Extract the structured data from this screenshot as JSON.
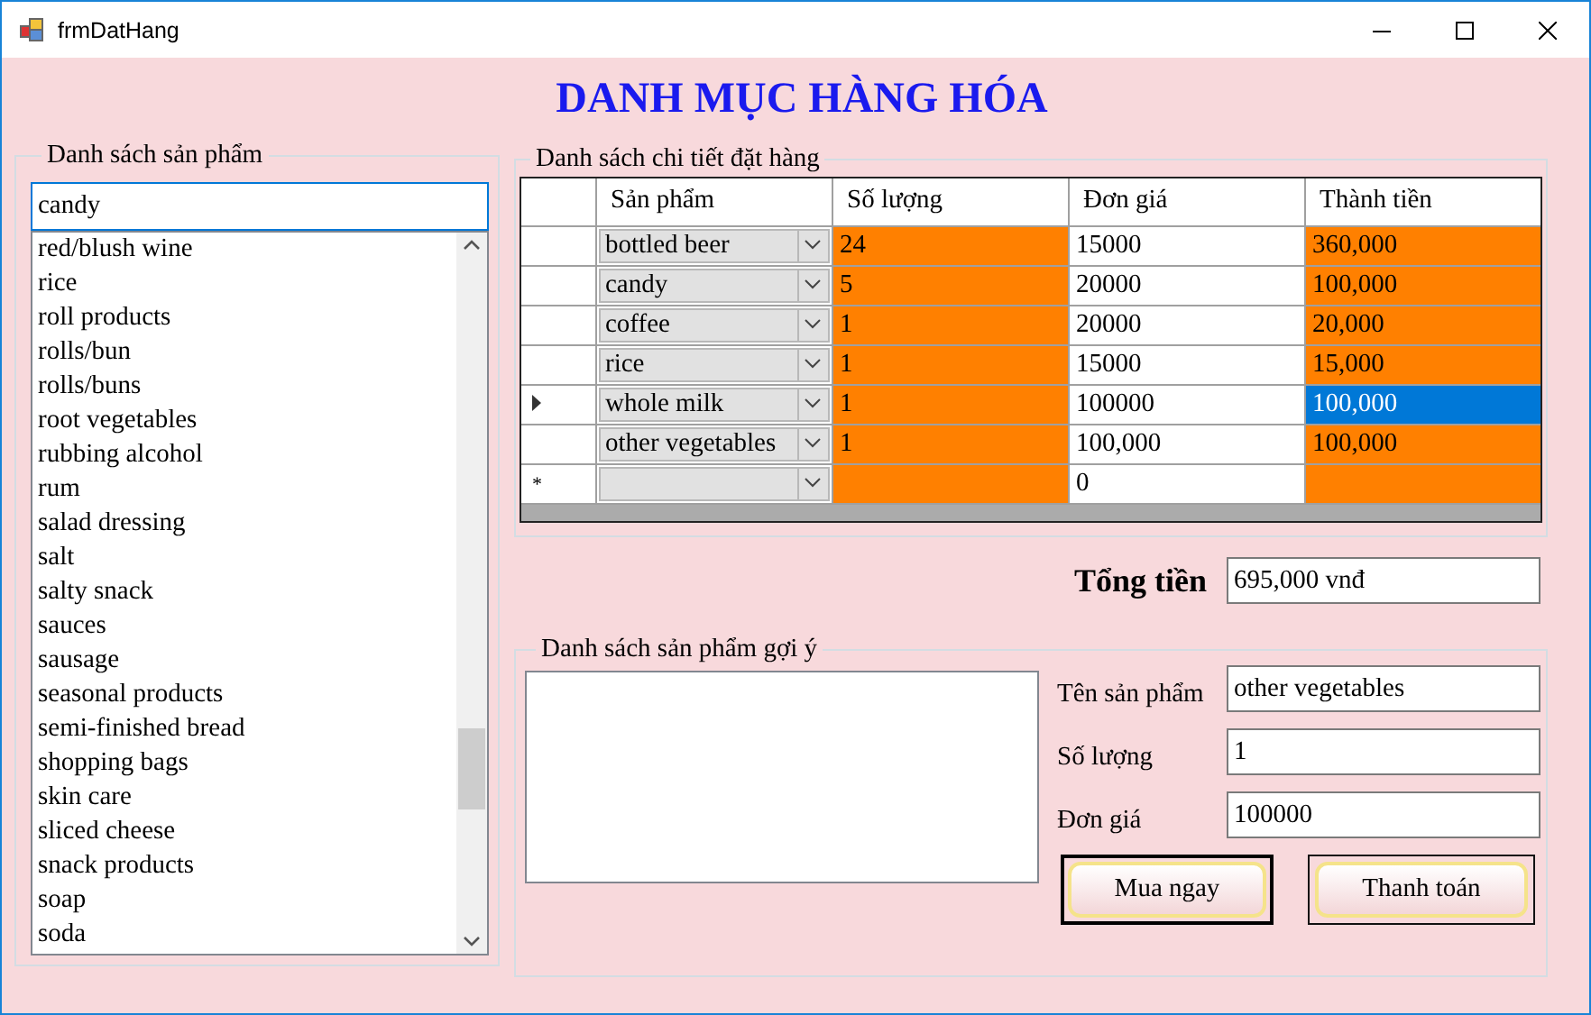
{
  "window": {
    "title": "frmDatHang"
  },
  "heading": "DANH MỤC HÀNG HÓA",
  "products": {
    "title": "Danh sách sản phẩm",
    "search": {
      "value": "candy"
    },
    "items": [
      {
        "label": "red/blush wine",
        "selected": false
      },
      {
        "label": "rice",
        "selected": false
      },
      {
        "label": "roll products",
        "selected": false
      },
      {
        "label": "rolls/bun",
        "selected": false
      },
      {
        "label": "rolls/buns",
        "selected": false
      },
      {
        "label": "root vegetables",
        "selected": false
      },
      {
        "label": "rubbing alcohol",
        "selected": false
      },
      {
        "label": "rum",
        "selected": false
      },
      {
        "label": "salad dressing",
        "selected": false
      },
      {
        "label": "salt",
        "selected": false
      },
      {
        "label": "salty snack",
        "selected": false
      },
      {
        "label": "sauces",
        "selected": false
      },
      {
        "label": "sausage",
        "selected": false
      },
      {
        "label": "seasonal products",
        "selected": false
      },
      {
        "label": "semi-finished bread",
        "selected": false
      },
      {
        "label": "shopping bags",
        "selected": false
      },
      {
        "label": "skin care",
        "selected": false
      },
      {
        "label": "sliced cheese",
        "selected": false
      },
      {
        "label": "snack products",
        "selected": false
      },
      {
        "label": "soap",
        "selected": false
      },
      {
        "label": "soda",
        "selected": false
      }
    ]
  },
  "order": {
    "title": "Danh sách chi tiết đặt hàng",
    "columns": [
      "Sản phẩm",
      "Số lượng",
      "Đơn giá",
      "Thành tiền"
    ],
    "rows": [
      {
        "product": "bottled beer",
        "quantity": "24",
        "price": "15000",
        "total": "360,000",
        "current": false,
        "total_selected": false
      },
      {
        "product": "candy",
        "quantity": "5",
        "price": "20000",
        "total": "100,000",
        "current": false,
        "total_selected": false
      },
      {
        "product": "coffee",
        "quantity": "1",
        "price": "20000",
        "total": "20,000",
        "current": false,
        "total_selected": false
      },
      {
        "product": "rice",
        "quantity": "1",
        "price": "15000",
        "total": "15,000",
        "current": false,
        "total_selected": false
      },
      {
        "product": "whole milk",
        "quantity": "1",
        "price": "100000",
        "total": "100,000",
        "current": true,
        "total_selected": true
      },
      {
        "product": "other vegetables",
        "quantity": "1",
        "price": "100,000",
        "total": "100,000",
        "current": false,
        "total_selected": false
      }
    ],
    "new_row": {
      "marker": "*",
      "price": "0"
    }
  },
  "total": {
    "label": "Tổng tiền",
    "value": "695,000 vnđ"
  },
  "suggest": {
    "title": "Danh sách sản phẩm gợi ý",
    "fields": [
      {
        "label": "Tên sản phẩm",
        "value": "other vegetables"
      },
      {
        "label": "Số lượng",
        "value": "1"
      },
      {
        "label": "Đơn giá",
        "value": "100000"
      }
    ],
    "buttons": [
      {
        "label": "Mua ngay",
        "default": true
      },
      {
        "label": "Thanh toán",
        "default": false
      }
    ]
  }
}
